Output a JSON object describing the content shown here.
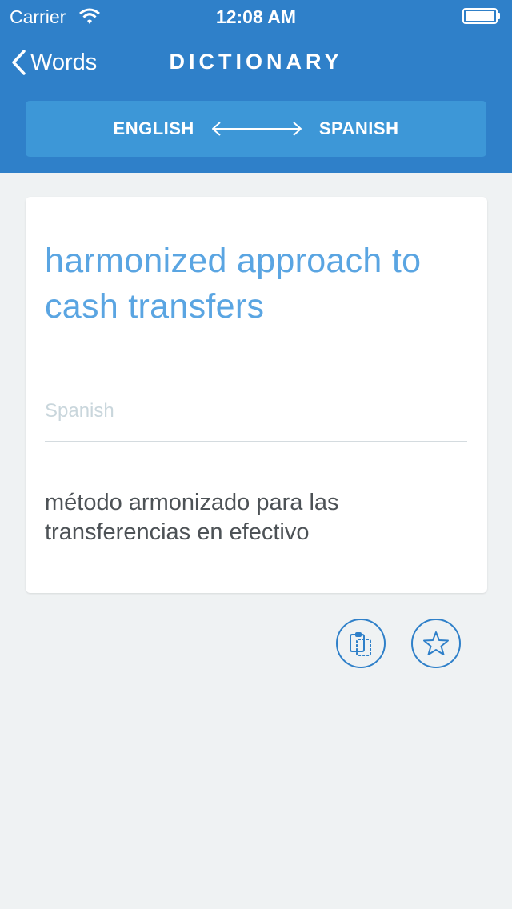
{
  "status_bar": {
    "carrier": "Carrier",
    "time": "12:08 AM"
  },
  "nav": {
    "back_label": "Words",
    "title": "DICTIONARY"
  },
  "language_bar": {
    "source": "ENGLISH",
    "target": "SPANISH"
  },
  "card": {
    "term": "harmonized approach to cash transfers",
    "field_label": "Spanish",
    "translation": "método armonizado para las transferencias en efectivo"
  },
  "actions": {
    "copy_icon": "copy-icon",
    "favorite_icon": "star-icon"
  },
  "colors": {
    "header": "#2f80c9",
    "lang_bar": "#3d97d7",
    "term": "#5aa5e2",
    "background": "#eff2f3"
  }
}
